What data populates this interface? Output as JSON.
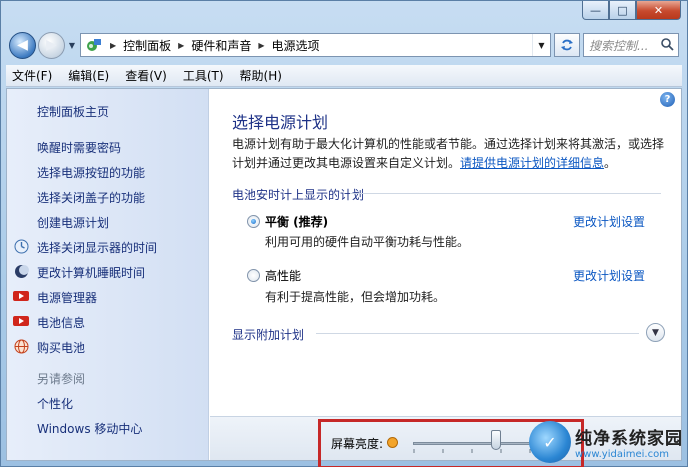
{
  "window": {
    "minimize_glyph": "—",
    "maximize_glyph": "□",
    "close_glyph": "✕"
  },
  "address_bar": {
    "breadcrumbs": [
      "控制面板",
      "硬件和声音",
      "电源选项"
    ],
    "search_placeholder": "搜索控制..."
  },
  "menubar": {
    "items": [
      "文件(F)",
      "编辑(E)",
      "查看(V)",
      "工具(T)",
      "帮助(H)"
    ]
  },
  "sidebar": {
    "home": "控制面板主页",
    "links": [
      "唤醒时需要密码",
      "选择电源按钮的功能",
      "选择关闭盖子的功能",
      "创建电源计划",
      "选择关闭显示器的时间",
      "更改计算机睡眠时间",
      "电源管理器",
      "电池信息",
      "购买电池"
    ],
    "see_also_header": "另请参阅",
    "see_also": [
      "个性化",
      "Windows 移动中心"
    ]
  },
  "main": {
    "title": "选择电源计划",
    "description": "电源计划有助于最大化计算机的性能或者节能。通过选择计划来将其激活，或选择计划并通过更改其电源设置来自定义计划。",
    "description_link": "请提供电源计划的详细信息",
    "description_end": "。",
    "group_header": "电池安时计上显示的计划",
    "plans": [
      {
        "name": "平衡 (推荐)",
        "description": "利用可用的硬件自动平衡功耗与性能。",
        "link": "更改计划设置",
        "selected": true
      },
      {
        "name": "高性能",
        "description": "有利于提高性能，但会增加功耗。",
        "link": "更改计划设置",
        "selected": false
      }
    ],
    "additional_plans": "显示附加计划",
    "help_glyph": "?"
  },
  "brightness": {
    "label": "屏幕亮度:",
    "level_percent": 70
  },
  "watermark": {
    "title": "纯净系统家园",
    "url": "www.yidaimei.com"
  }
}
